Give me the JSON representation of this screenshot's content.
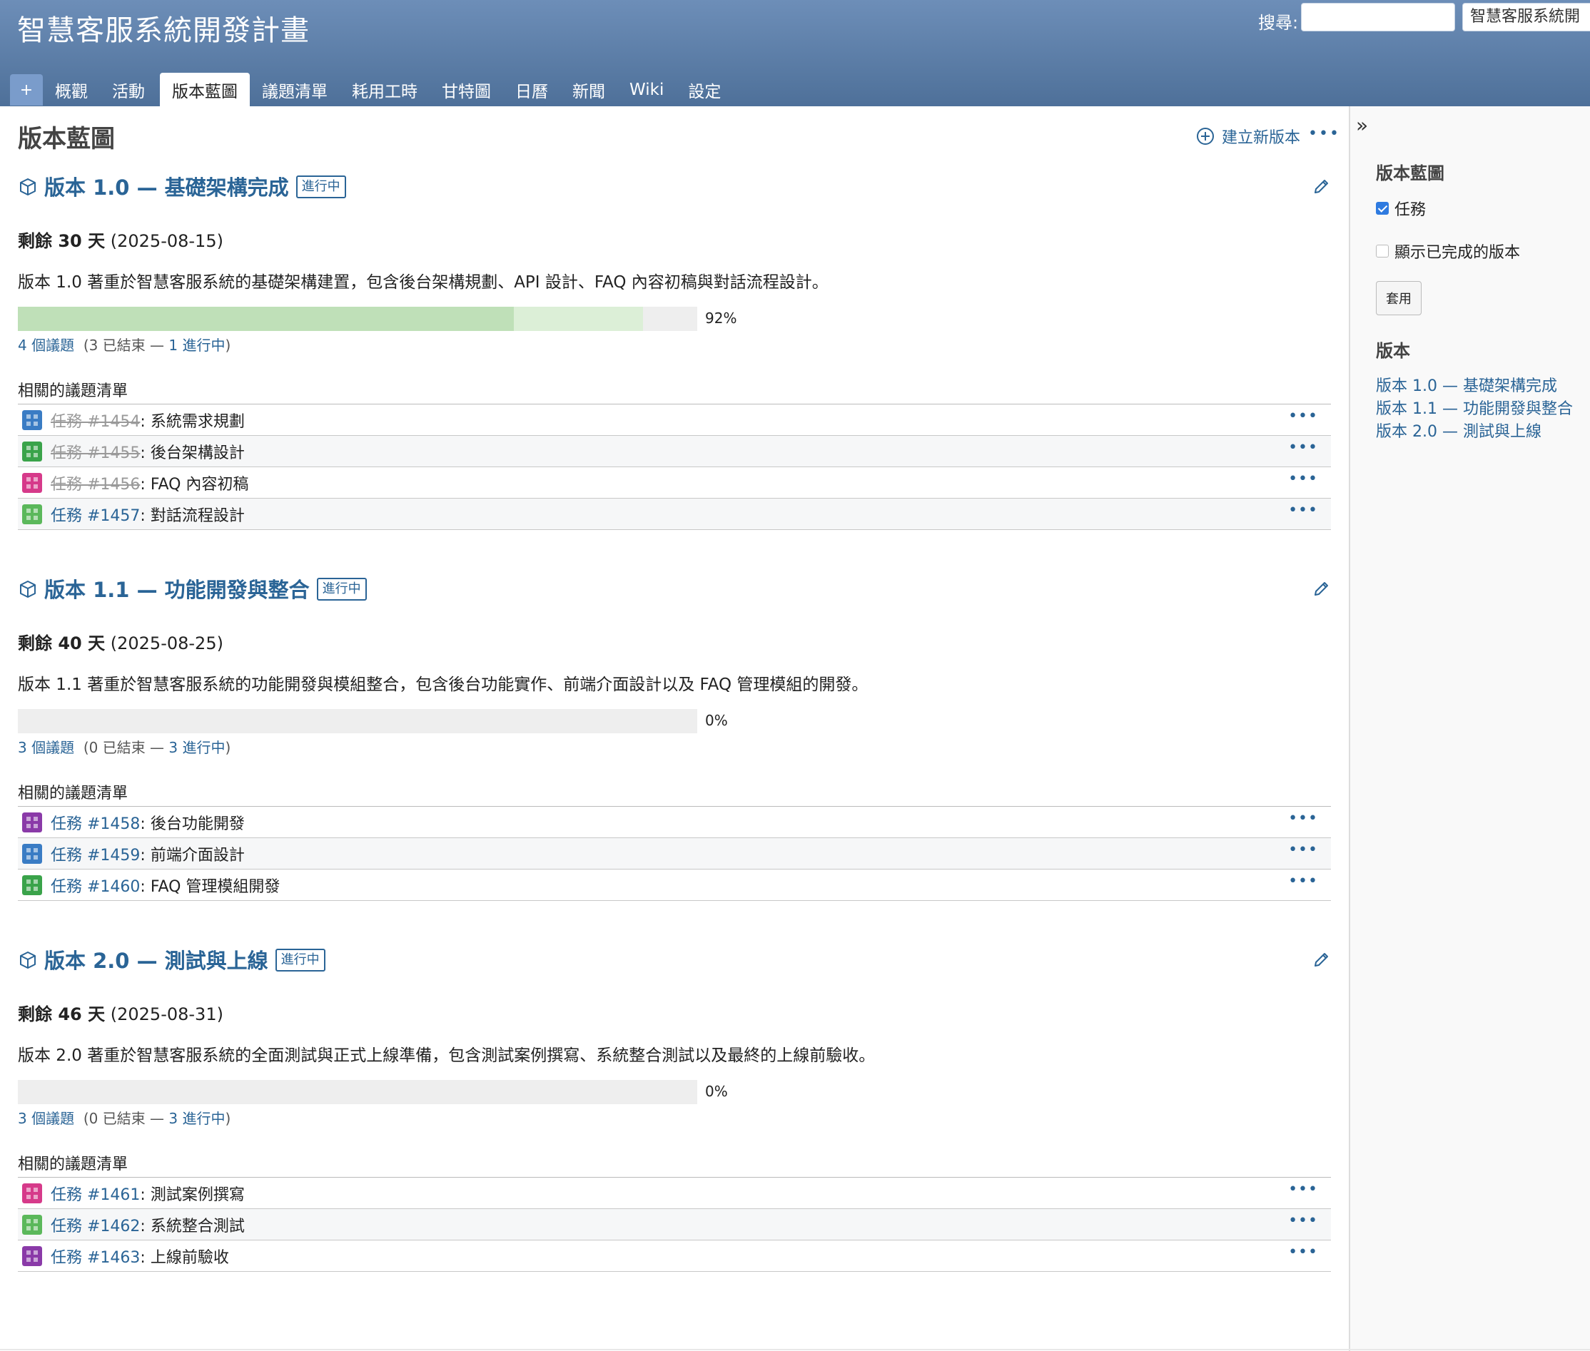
{
  "header": {
    "title": "智慧客服系統開發計畫",
    "search_label": "搜尋:",
    "search_value": "",
    "project_jump": "智慧客服系統開",
    "new_tab": "+"
  },
  "tabs": [
    "概觀",
    "活動",
    "版本藍圖",
    "議題清單",
    "耗用工時",
    "甘特圖",
    "日曆",
    "新聞",
    "Wiki",
    "設定"
  ],
  "main": {
    "page_title": "版本藍圖",
    "new_version_label": "建立新版本",
    "menu_dots": "•••"
  },
  "versions": [
    {
      "title": "版本 1.0 — 基礎架構完成",
      "status": "進行中",
      "due_label": "剩餘 30 天",
      "due_date": "(2025-08-15)",
      "description": "版本 1.0 著重於智慧客服系統的基礎架構建置，包含後台架構規劃、API 設計、FAQ 內容初稿與對話流程設計。",
      "progress_closed": 0.73,
      "progress_done": 0.92,
      "percent": "92%",
      "issue_count": "4 個議題",
      "closed_text": "(3 已結束 — ",
      "open_text": "1 進行中",
      "close_paren": ")",
      "related_title": "相關的議題清單",
      "issues": [
        {
          "ref": "任務 #1454",
          "subject": ": 系統需求規劃",
          "closed": true,
          "avatar": "#3a7cc4"
        },
        {
          "ref": "任務 #1455",
          "subject": ": 後台架構設計",
          "closed": true,
          "avatar": "#3aa34a"
        },
        {
          "ref": "任務 #1456",
          "subject": ": FAQ 內容初稿",
          "closed": true,
          "avatar": "#d63a8a"
        },
        {
          "ref": "任務 #1457",
          "subject": ": 對話流程設計",
          "closed": false,
          "avatar": "#5bb85b"
        }
      ]
    },
    {
      "title": "版本 1.1 — 功能開發與整合",
      "status": "進行中",
      "due_label": "剩餘 40 天",
      "due_date": "(2025-08-25)",
      "description": "版本 1.1 著重於智慧客服系統的功能開發與模組整合，包含後台功能實作、前端介面設計以及 FAQ 管理模組的開發。",
      "progress_closed": 0,
      "progress_done": 0,
      "percent": "0%",
      "issue_count": "3 個議題",
      "closed_text": "(0 已結束 — ",
      "open_text": "3 進行中",
      "close_paren": ")",
      "related_title": "相關的議題清單",
      "issues": [
        {
          "ref": "任務 #1458",
          "subject": ": 後台功能開發",
          "closed": false,
          "avatar": "#8a3aa8"
        },
        {
          "ref": "任務 #1459",
          "subject": ": 前端介面設計",
          "closed": false,
          "avatar": "#3a7cc4"
        },
        {
          "ref": "任務 #1460",
          "subject": ": FAQ 管理模組開發",
          "closed": false,
          "avatar": "#3aa34a"
        }
      ]
    },
    {
      "title": "版本 2.0 — 測試與上線",
      "status": "進行中",
      "due_label": "剩餘 46 天",
      "due_date": "(2025-08-31)",
      "description": "版本 2.0 著重於智慧客服系統的全面測試與正式上線準備，包含測試案例撰寫、系統整合測試以及最終的上線前驗收。",
      "progress_closed": 0,
      "progress_done": 0,
      "percent": "0%",
      "issue_count": "3 個議題",
      "closed_text": "(0 已結束 — ",
      "open_text": "3 進行中",
      "close_paren": ")",
      "related_title": "相關的議題清單",
      "issues": [
        {
          "ref": "任務 #1461",
          "subject": ": 測試案例撰寫",
          "closed": false,
          "avatar": "#d63a8a"
        },
        {
          "ref": "任務 #1462",
          "subject": ": 系統整合測試",
          "closed": false,
          "avatar": "#5bb85b"
        },
        {
          "ref": "任務 #1463",
          "subject": ": 上線前驗收",
          "closed": false,
          "avatar": "#8a3aa8"
        }
      ]
    }
  ],
  "sidebar": {
    "toggle": "»",
    "heading": "版本藍圖",
    "tracker_task": "任務",
    "show_completed": "顯示已完成的版本",
    "apply": "套用",
    "versions_heading": "版本",
    "version_links": [
      "版本 1.0 — 基礎架構完成",
      "版本 1.1 — 功能開發與整合",
      "版本 2.0 — 測試與上線"
    ]
  }
}
